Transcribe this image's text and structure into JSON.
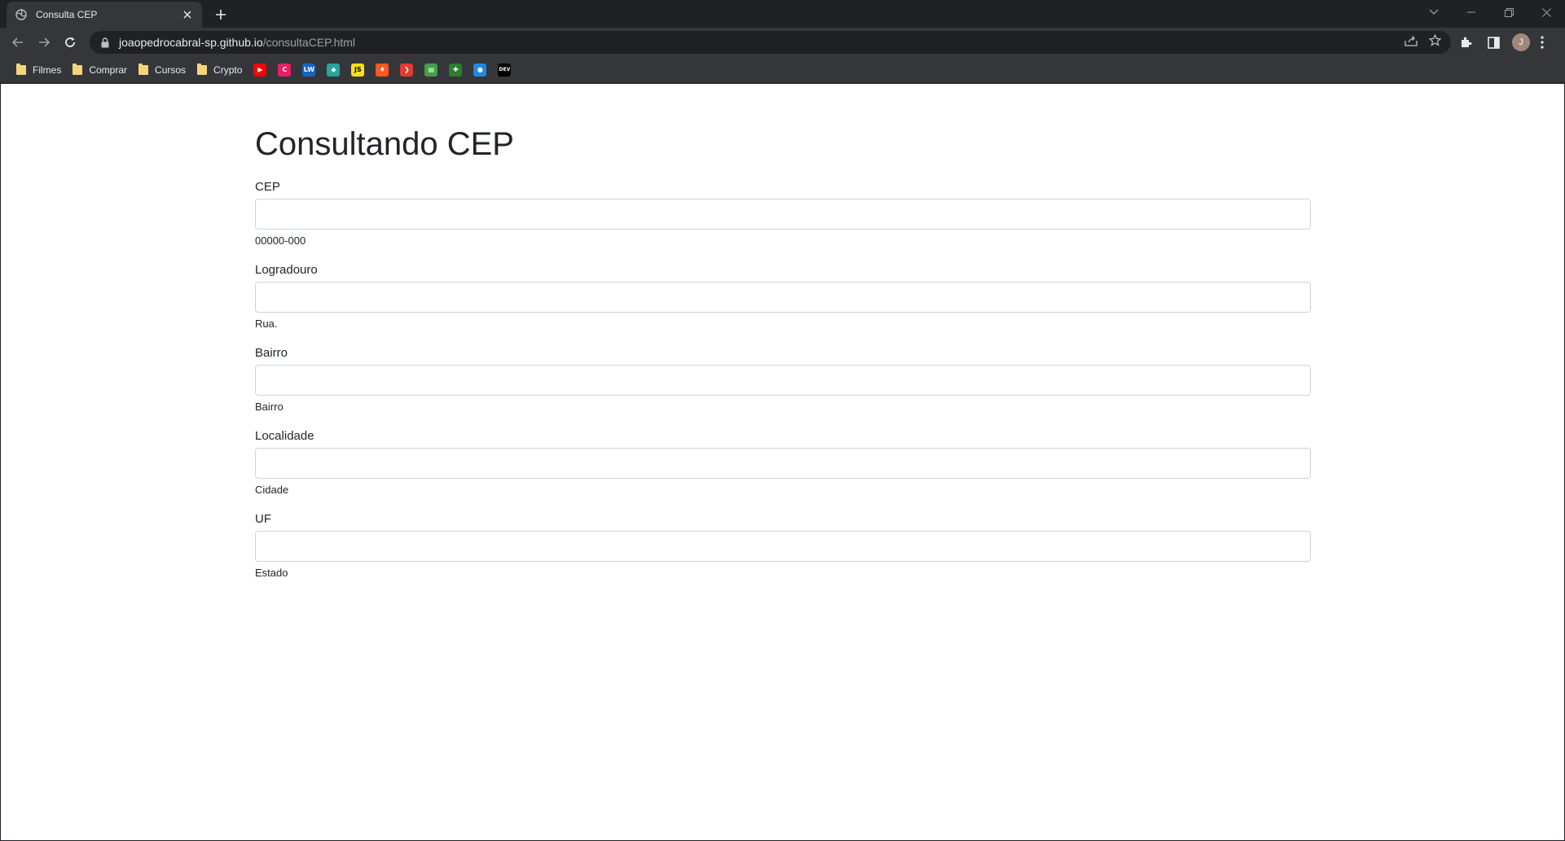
{
  "browser": {
    "tab_title": "Consulta CEP",
    "url_host": "joaopedrocabral-sp.github.io",
    "url_path": "/consultaCEP.html",
    "avatar_letter": "J",
    "bookmarks_folders": [
      {
        "label": "Filmes"
      },
      {
        "label": "Comprar"
      },
      {
        "label": "Cursos"
      },
      {
        "label": "Crypto"
      }
    ],
    "bookmark_icons": [
      {
        "name": "youtube-icon",
        "color": "#ff0000",
        "glyph": "▶"
      },
      {
        "name": "multicolor-c-icon",
        "color": "#e91e63",
        "glyph": "C"
      },
      {
        "name": "lw-icon",
        "color": "#1565c0",
        "glyph": "LW"
      },
      {
        "name": "green-square-icon",
        "color": "#26a69a",
        "glyph": "◆"
      },
      {
        "name": "js-icon",
        "color": "#f7df1e",
        "glyph": "JS"
      },
      {
        "name": "fire-icon",
        "color": "#ff5722",
        "glyph": "♦"
      },
      {
        "name": "red-arrow-icon",
        "color": "#e53935",
        "glyph": "❯"
      },
      {
        "name": "book-icon",
        "color": "#43a047",
        "glyph": "▤"
      },
      {
        "name": "green-plus-icon",
        "color": "#2e7d32",
        "glyph": "✚"
      },
      {
        "name": "blue-circle-icon",
        "color": "#1e88e5",
        "glyph": "●"
      },
      {
        "name": "dev-icon",
        "color": "#000000",
        "glyph": "DEV"
      }
    ]
  },
  "page": {
    "title": "Consultando CEP",
    "fields": [
      {
        "label": "CEP",
        "value": "",
        "help": "00000-000"
      },
      {
        "label": "Logradouro",
        "value": "",
        "help": "Rua."
      },
      {
        "label": "Bairro",
        "value": "",
        "help": "Bairro"
      },
      {
        "label": "Localidade",
        "value": "",
        "help": "Cidade"
      },
      {
        "label": "UF",
        "value": "",
        "help": "Estado"
      }
    ]
  }
}
